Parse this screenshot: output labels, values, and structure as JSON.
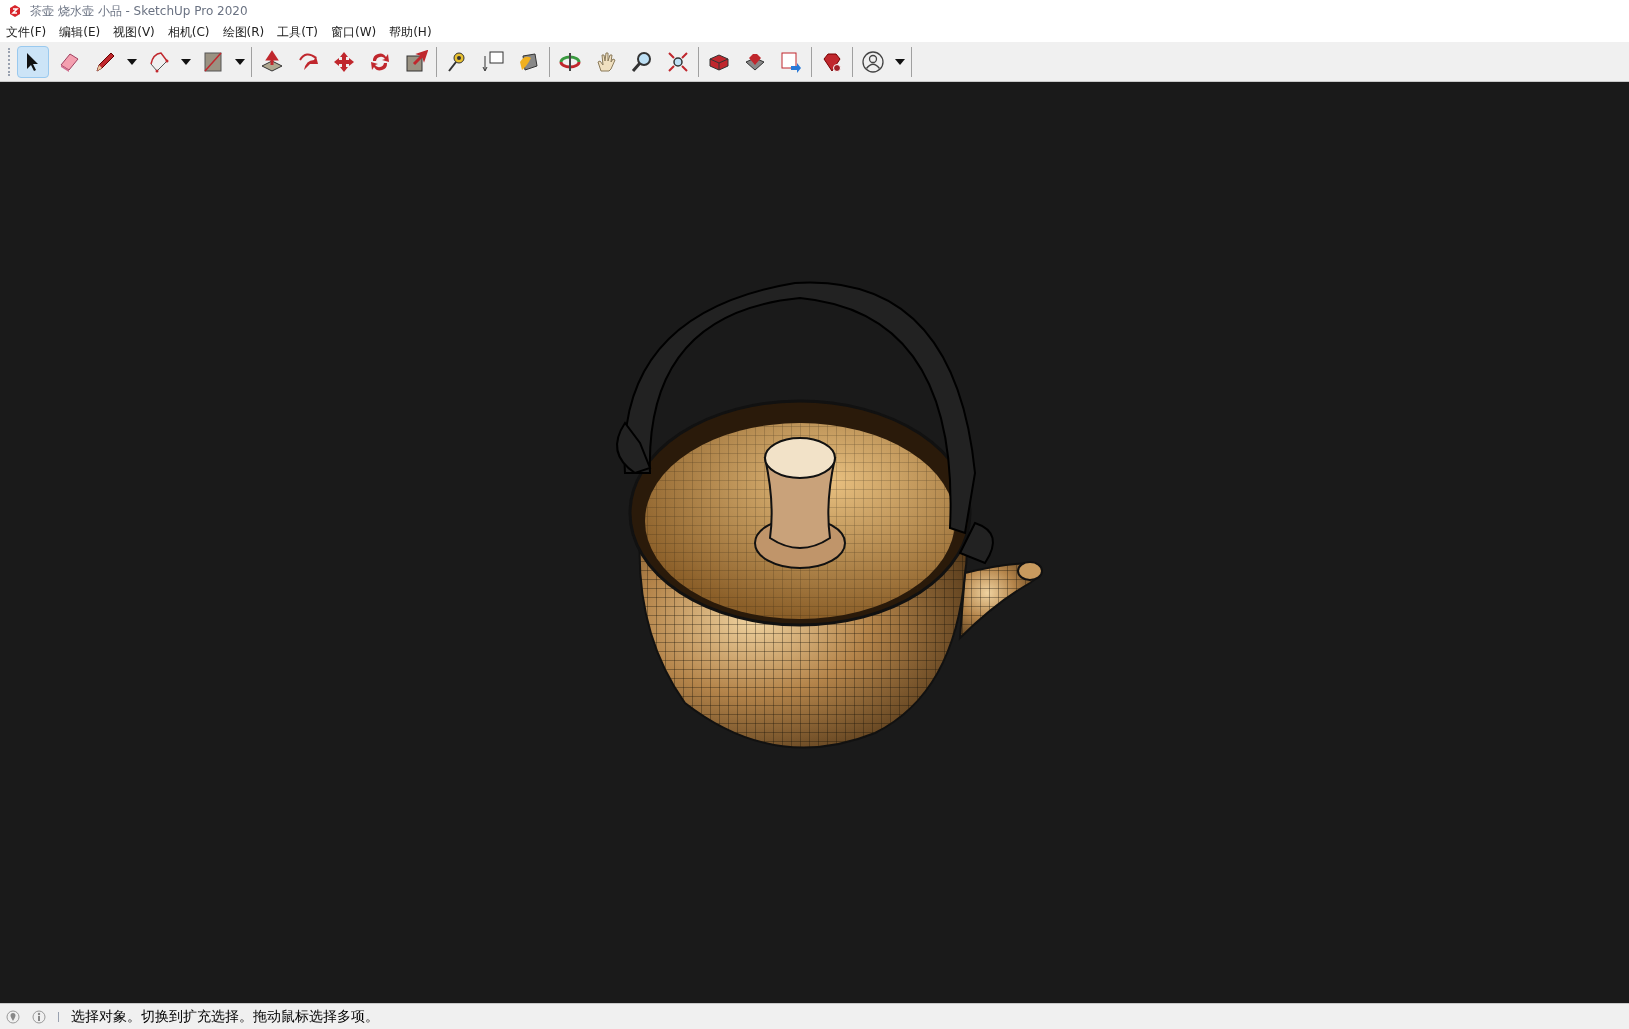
{
  "window": {
    "title": "茶壶 烧水壶 小品 - SketchUp Pro 2020"
  },
  "menu": [
    "文件(F)",
    "编辑(E)",
    "视图(V)",
    "相机(C)",
    "绘图(R)",
    "工具(T)",
    "窗口(W)",
    "帮助(H)"
  ],
  "toolbar": {
    "groups": [
      [
        {
          "kind": "button",
          "selected": true
        },
        {
          "kind": "button",
          "selected": false
        },
        {
          "kind": "split",
          "selected": false
        },
        {
          "kind": "split",
          "selected": false
        },
        {
          "kind": "split",
          "selected": false
        }
      ],
      [
        {
          "kind": "button",
          "selected": false
        },
        {
          "kind": "button",
          "selected": false
        },
        {
          "kind": "button",
          "selected": false
        },
        {
          "kind": "button",
          "selected": false
        },
        {
          "kind": "button",
          "selected": false
        }
      ],
      [
        {
          "kind": "button",
          "selected": false
        },
        {
          "kind": "button",
          "selected": false
        },
        {
          "kind": "button",
          "selected": false
        }
      ],
      [
        {
          "kind": "button",
          "selected": false
        },
        {
          "kind": "button",
          "selected": false
        },
        {
          "kind": "button",
          "selected": false
        },
        {
          "kind": "button",
          "selected": false
        }
      ],
      [
        {
          "kind": "button",
          "selected": false
        },
        {
          "kind": "button",
          "selected": false
        },
        {
          "kind": "button",
          "selected": false
        }
      ],
      [
        {
          "kind": "button",
          "selected": false
        }
      ],
      [
        {
          "kind": "split",
          "selected": false
        }
      ]
    ]
  },
  "status_bar": {
    "message": "选择对象。切换到扩充选择。拖动鼠标选择多项。"
  }
}
